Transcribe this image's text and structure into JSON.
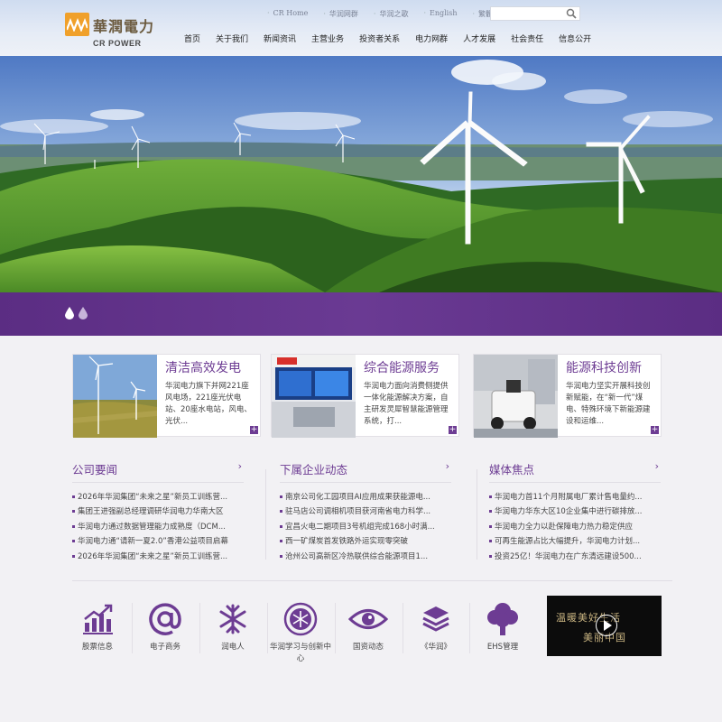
{
  "brand": {
    "name_cn": "華潤電力",
    "name_en": "CR POWER",
    "color_accent": "#6d3c93",
    "color_logo": "#f0a02a"
  },
  "toplinks": [
    "CR Home",
    "华润网群",
    "华润之歌",
    "English",
    "繁體版"
  ],
  "search": {
    "placeholder": ""
  },
  "nav": [
    "首页",
    "关于我们",
    "新闻资讯",
    "主营业务",
    "投资者关系",
    "电力网群",
    "人才发展",
    "社会责任",
    "信息公开"
  ],
  "hero": {
    "slide_count": 2,
    "active_slide": 1
  },
  "cards": [
    {
      "title": "清洁高效发电",
      "desc": "华润电力旗下并网221座风电场，221座光伏电站、20座水电站，风电、光伏..."
    },
    {
      "title": "综合能源服务",
      "desc": "华润电力面向消费侧提供一体化能源解决方案，自主研发灵犀智慧能源管理系统，打..."
    },
    {
      "title": "能源科技创新",
      "desc": "华润电力坚实开展科技创新赋能，在“新一代”煤电、特殊环境下新能源建设和运维..."
    }
  ],
  "news": [
    {
      "title": "公司要闻",
      "items": [
        "2026年华润集团“未来之星”新员工训练营...",
        "集团王进强副总经理调研华润电力华南大区",
        "华润电力通过数据管理能力成熟度（DCM...",
        "华润电力通“请新一夏2.0”香港公益项目启幕",
        "2026年华润集团“未来之星”新员工训练营..."
      ]
    },
    {
      "title": "下属企业动态",
      "items": [
        "南京公司化工园项目AI应用成果获能源电...",
        "驻马店公司调相机项目获河南省电力科学...",
        "宜昌火电二期项目3号机组完成168小时满...",
        "西一矿煤炭首发铁路外运实现零突破",
        "沧州公司高新区冷热联供综合能源项目1..."
      ]
    },
    {
      "title": "媒体焦点",
      "items": [
        "华润电力首11个月附属电厂累计售电量约...",
        "华润电力华东大区10企业集中进行碳排放...",
        "华润电力全力以赴保障电力热力稳定供应",
        "可再生能源占比大幅提升，华润电力计划...",
        "投资25亿！华润电力在广东清远建设500..."
      ]
    }
  ],
  "services": [
    {
      "label": "股票信息",
      "icon": "stock-chart-icon"
    },
    {
      "label": "电子商务",
      "icon": "at-sign-icon"
    },
    {
      "label": "润电人",
      "icon": "snowflake-icon"
    },
    {
      "label": "华润学习与创新中心",
      "icon": "emblem-icon"
    },
    {
      "label": "国资动态",
      "icon": "eye-icon"
    },
    {
      "label": "《华润》",
      "icon": "layers-icon"
    },
    {
      "label": "EHS管理",
      "icon": "tree-icon"
    }
  ],
  "video": {
    "text_line1": "温暖美好生活",
    "text_line2": "美丽中国"
  }
}
